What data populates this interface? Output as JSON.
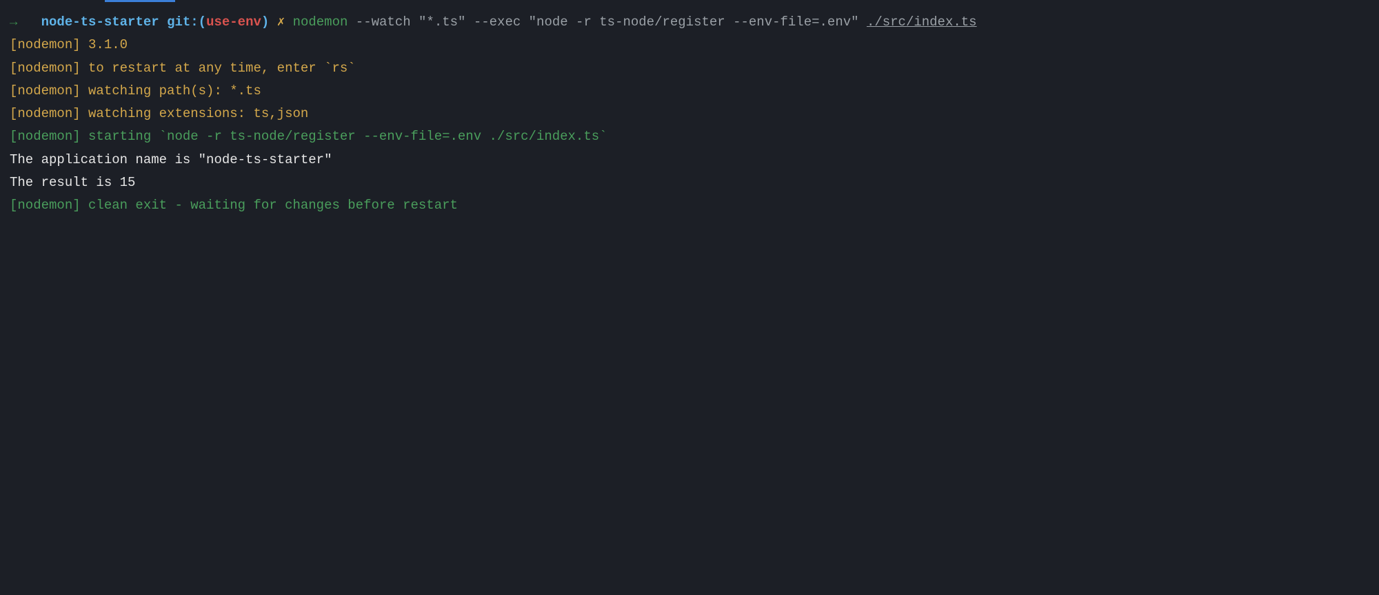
{
  "prompt": {
    "arrow": "→",
    "dir": "node-ts-starter",
    "git_label": "git:",
    "git_paren_open": "(",
    "git_branch": "use-env",
    "git_paren_close": ")",
    "cross": "✗",
    "cmd_nodemon": "nodemon",
    "cmd_args": " --watch \"*.ts\" --exec \"node -r ts-node/register --env-file=.env\" ",
    "cmd_file": "./src/index.ts"
  },
  "output": {
    "line1": "[nodemon] 3.1.0",
    "line2": "[nodemon] to restart at any time, enter `rs`",
    "line3": "[nodemon] watching path(s): *.ts",
    "line4": "[nodemon] watching extensions: ts,json",
    "line5": "[nodemon] starting `node -r ts-node/register --env-file=.env ./src/index.ts`",
    "line6": "The application name is \"node-ts-starter\"",
    "line7": "The result is 15",
    "line8": "[nodemon] clean exit - waiting for changes before restart"
  }
}
